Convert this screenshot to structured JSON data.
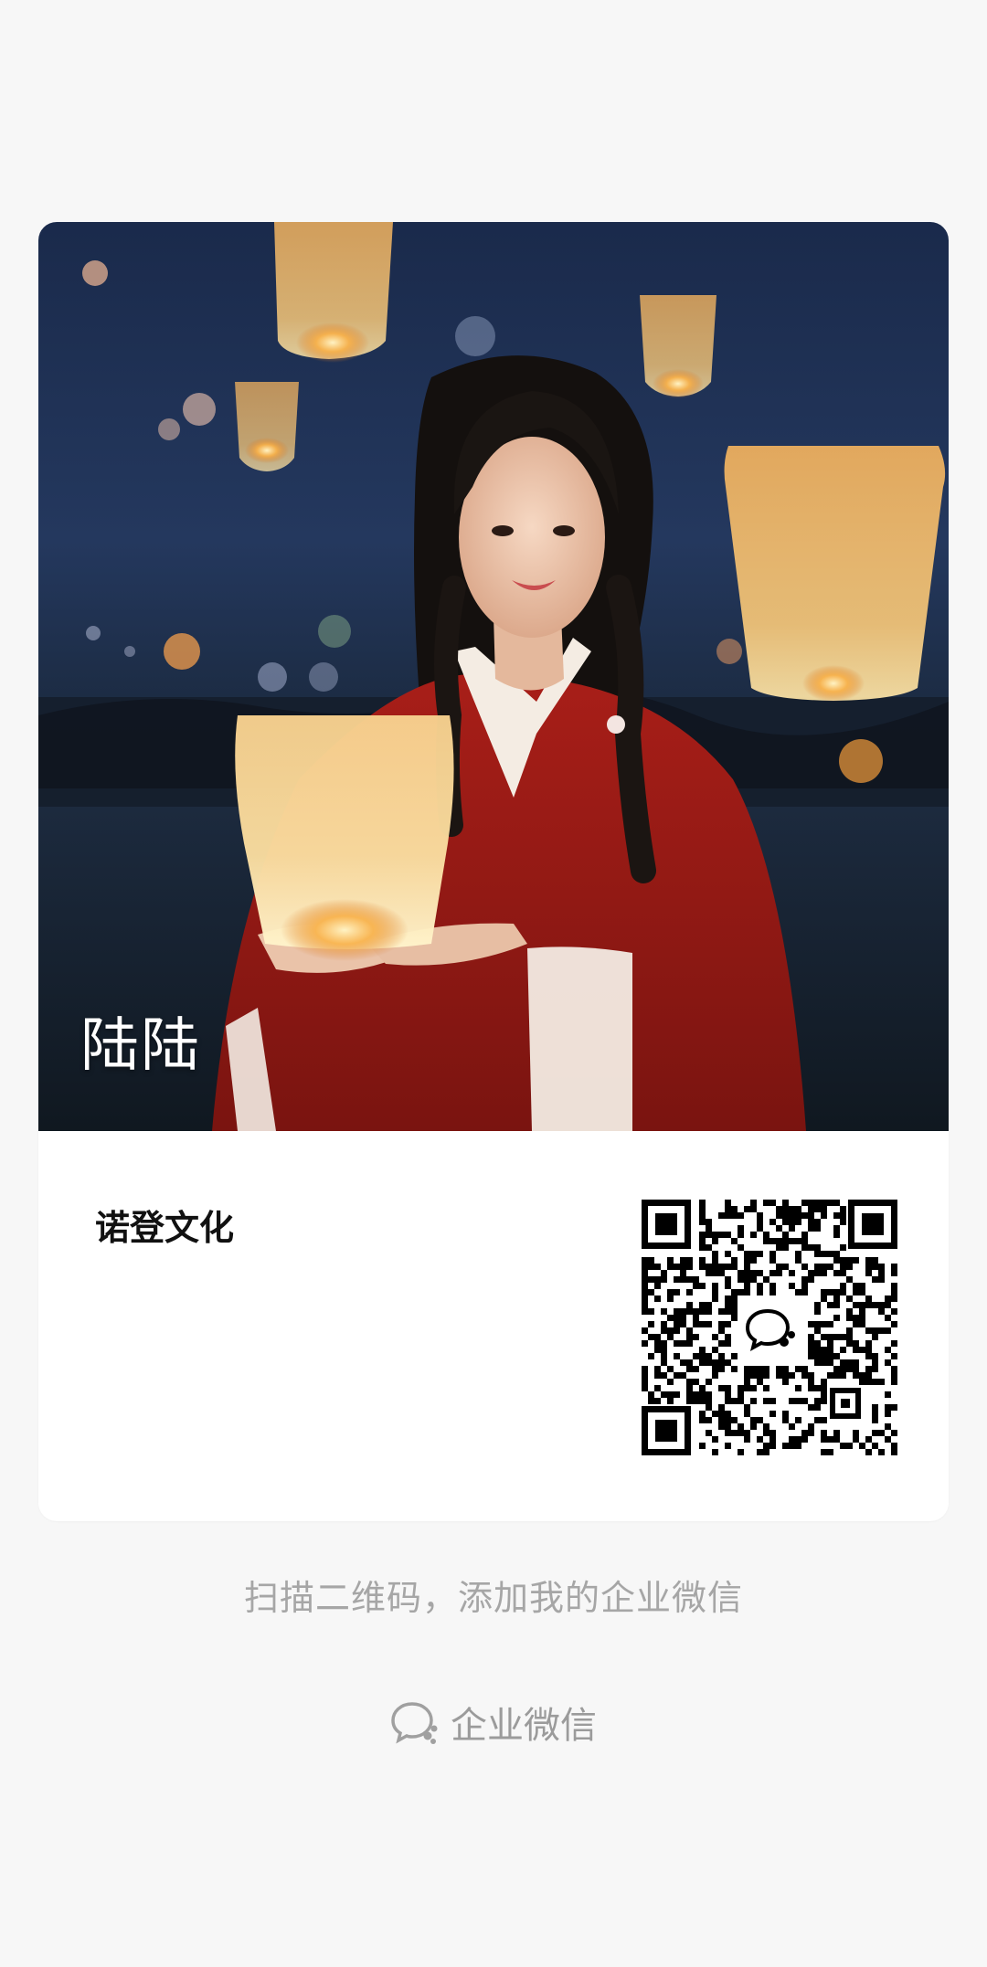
{
  "card": {
    "display_name": "陆陆",
    "company": "诺登文化"
  },
  "caption": "扫描二维码，添加我的企业微信",
  "brand": {
    "label": "企业微信",
    "icon": "wecom-chat-icon"
  },
  "colors": {
    "background": "#f7f7f7",
    "card": "#ffffff",
    "caption_text": "#a6a6a6",
    "dress": "#b5201a"
  }
}
